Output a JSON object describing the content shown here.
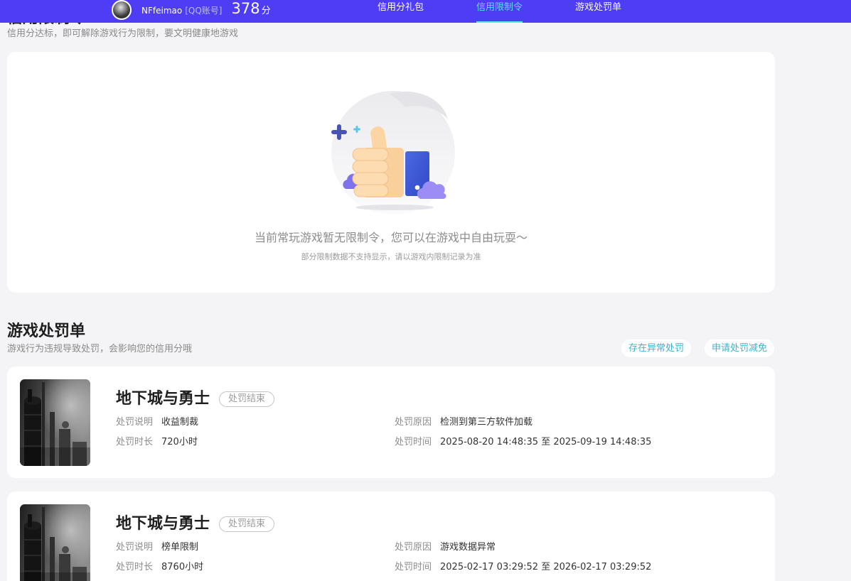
{
  "header": {
    "username": "NFfeimao",
    "account_type": "[QQ账号]",
    "score": "378",
    "score_unit": "分",
    "nav": [
      {
        "label": "信用分礼包",
        "active": false
      },
      {
        "label": "信用限制令",
        "active": true
      },
      {
        "label": "游戏处罚单",
        "active": false
      }
    ]
  },
  "restriction_section": {
    "title": "信用限制令",
    "subtitle": "信用分达标，即可解除游戏行为限制，要文明健康地游戏",
    "empty_message": "当前常玩游戏暂无限制令，您可以在游戏中自由玩耍～",
    "empty_note": "部分限制数据不支持显示，请以游戏内限制记录为准",
    "empty_icon": "thumbs-up-illustration"
  },
  "penalty_section": {
    "title": "游戏处罚单",
    "subtitle": "游戏行为违规导致处罚，会影响您的信用分哦",
    "actions": [
      "存在异常处罚",
      "申请处罚减免"
    ],
    "field_labels": {
      "description": "处罚说明",
      "reason": "处罚原因",
      "duration": "处罚时长",
      "time": "处罚时间"
    },
    "records": [
      {
        "game": "地下城与勇士",
        "status": "处罚结束",
        "description": "收益制裁",
        "reason": "检测到第三方软件加载",
        "duration": "720小时",
        "time": "2025-08-20 14:48:35 至 2025-09-19 14:48:35"
      },
      {
        "game": "地下城与勇士",
        "status": "处罚结束",
        "description": "榜单限制",
        "reason": "游戏数据异常",
        "duration": "8760小时",
        "time": "2025-02-17 03:29:52 至 2026-02-17 03:29:52"
      }
    ]
  },
  "colors": {
    "header_background": "#4e3df4",
    "active_nav": "#5fdff8",
    "action_text": "#3cb2d3",
    "page_background": "#f4f4f6"
  }
}
